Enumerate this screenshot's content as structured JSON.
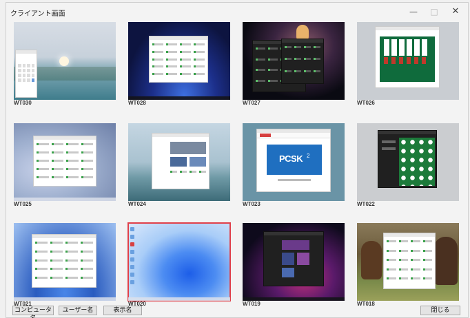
{
  "window": {
    "title": "クライアント画面",
    "minimize": "—",
    "maximize": "□",
    "close": "✕"
  },
  "clients": [
    {
      "label": "WT030",
      "selected": false
    },
    {
      "label": "WT028",
      "selected": false
    },
    {
      "label": "WT027",
      "selected": false
    },
    {
      "label": "WT026",
      "selected": false
    },
    {
      "label": "WT025",
      "selected": false
    },
    {
      "label": "WT024",
      "selected": false
    },
    {
      "label": "WT023",
      "selected": false
    },
    {
      "label": "WT022",
      "selected": false
    },
    {
      "label": "WT021",
      "selected": false
    },
    {
      "label": "WT020",
      "selected": true
    },
    {
      "label": "WT019",
      "selected": false
    },
    {
      "label": "WT018",
      "selected": false
    }
  ],
  "thumb_text": {
    "pcsk_logo": "PCSK",
    "pcsk_sub": "2"
  },
  "buttons": {
    "computer_name": "コンピュータ名",
    "user_name": "ユーザー名",
    "display_name": "表示名",
    "close": "閉じる"
  }
}
